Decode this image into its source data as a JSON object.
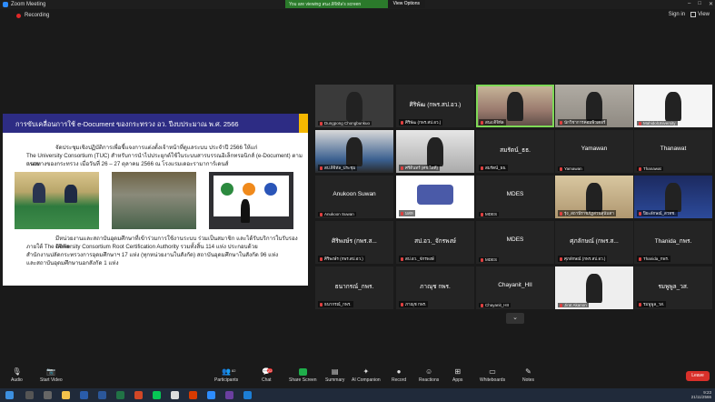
{
  "window": {
    "title": "Zoom Meeting"
  },
  "share_banner": {
    "text": "You are viewing สนง.ดิจิทัล's screen",
    "view_options": "View Options"
  },
  "recording": {
    "label": "Recording"
  },
  "top_right": {
    "sign_in": "Sign in",
    "view": "View"
  },
  "slide": {
    "title": "การขับเคลื่อนการใช้ e-Document ของกระทรวง อว. ปีงบประมาณ พ.ศ. 2566",
    "p1_l1": "จัดประชุมเชิงปฏิบัติการเพื่อชี้แจงการแต่งตั้งเจ้าหน้าที่ดูแลระบบ ประจำปี 2566 ให้แก่",
    "p1_l2": "The University Consortium (TUC) สำหรับการนำไปประยุกต์ใช้ในระบบสารบรรณอิเล็กทรอนิกส์ (e-Document) ตามกรอบ",
    "p1_l3": "แนวทางของกระทรวง เมื่อวันที่ 26 – 27 ตุลาคม 2566 ณ โรงแรมเดอะรามาการ์เดนส์",
    "p2_l1": "มีหน่วยงานและสถาบันอุดมศึกษาที่เข้าร่วมการใช้งานระบบ ร่วมเป็นสมาชิก และได้รับบริการใบรับรองดิจิทัล",
    "p2_l2": "ภายใต้ The University Consortium Root Certification Authority รวมทั้งสิ้น 114 แห่ง ประกอบด้วย",
    "p2_l3": "สำนักงานปลัดกระทรวงการอุดมศึกษาฯ 17 แห่ง (ทุกหน่วยงานในสังกัด) สถาบันอุดมศึกษาในสังกัด 96 แห่ง",
    "p2_l4": "และสถาบันอุดมศึกษานอกสังกัด 1 แห่ง"
  },
  "participants": [
    {
      "display": "",
      "label": "Dungpong Chongbunkuo",
      "video": true
    },
    {
      "display": "ศิริพัฒ (กพร.สป.อว.)",
      "label": "ศิริพัฒ (กพร.สป.อว.)",
      "video": false
    },
    {
      "display": "",
      "label": "สนง.ดิจิทัล",
      "video": true
    },
    {
      "display": "",
      "label": "นักวิชาการคอมพิวเตอร์",
      "video": true
    },
    {
      "display": "",
      "label": "MahidolUniversity",
      "video": true
    },
    {
      "display": "",
      "label": "สป.ดิจิทัล_ประชุม",
      "video": true
    },
    {
      "display": "",
      "label": "ศรีดินทร์ (ศช.ไอที)",
      "video": true
    },
    {
      "display": "สมรัตน์_ธธ.",
      "label": "สมรัตน์_ธธ.",
      "video": false
    },
    {
      "display": "Yamawan",
      "label": "Yamawan",
      "video": false
    },
    {
      "display": "Thanawat",
      "label": "Thanawat",
      "video": false
    },
    {
      "display": "Anukoon Suwan",
      "label": "Anukoon Suwan",
      "video": false
    },
    {
      "display": "",
      "label": "มสท",
      "video": true
    },
    {
      "display": "MDES",
      "label": "MDES",
      "video": false
    },
    {
      "display": "",
      "label": "รุ่ง_สถานีราชภัฏสวนสุนันทา",
      "video": true
    },
    {
      "display": "",
      "label": "ปิยะลักษณ์_สวทช.",
      "video": true
    },
    {
      "display": "ศิริพงษ์ร (กพร.ส...",
      "label": "ศิริพงษ์ร (กพร.สป.อว.)",
      "video": false
    },
    {
      "display": "สป.อว._จักรพงษ์",
      "label": "สป.อว._จักรพงษ์",
      "video": false
    },
    {
      "display": "MDES",
      "label": "MDES",
      "video": false
    },
    {
      "display": "ศุภลักษณ์ (กพร.ส...",
      "label": "ศุภลักษณ์ (กพร.สป.อว.)",
      "video": false
    },
    {
      "display": "Thanida_กพร.",
      "label": "Thanida_กพร.",
      "video": false
    },
    {
      "display": "ธนากรณ์_กพร.",
      "label": "ธนากรณ์_กพร.",
      "video": false
    },
    {
      "display": "ภาณุช กพร.",
      "label": "ภาณุช กพร.",
      "video": false
    },
    {
      "display": "Chayanit_HII",
      "label": "Chayanit_HII",
      "video": false
    },
    {
      "display": "",
      "label": "Jirat Akanon",
      "video": true
    },
    {
      "display": "รมพูพูล_วส.",
      "label": "รมพูพูล_วส.",
      "video": false
    }
  ],
  "pagination": "⌄",
  "toolbar": {
    "audio": "Audio",
    "start_video": "Start Video",
    "participants": "Participants",
    "participants_count": "82",
    "chat": "Chat",
    "chat_badge": "22",
    "share_screen": "Share Screen",
    "summary": "Summary",
    "ai_companion": "AI Companion",
    "record": "Record",
    "reactions": "Reactions",
    "apps": "Apps",
    "whiteboards": "Whiteboards",
    "notes": "Notes",
    "leave": "Leave"
  },
  "taskbar": {
    "time": "9:23",
    "date": "21/11/2566"
  }
}
